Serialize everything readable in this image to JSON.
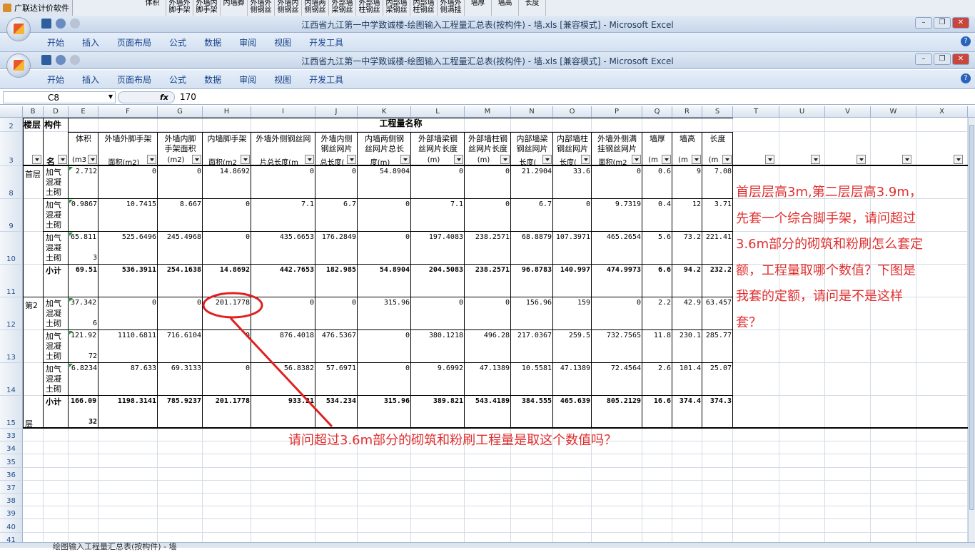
{
  "background_app": {
    "label": "广联达计价软件",
    "headers": [
      "体积",
      "外墙外脚手架",
      "外墙内脚手架",
      "内墙脚",
      "外墙外侧钢丝",
      "外墙内侧钢丝",
      "内墙两侧钢丝",
      "外部墙梁钢丝",
      "外部墙柱钢丝",
      "内部墙梁钢丝",
      "内部墙柱钢丝",
      "外墙外侧满挂",
      "墙厚",
      "墙高",
      "长度"
    ]
  },
  "windows": [
    {
      "title": "江西省九江第一中学致诚楼-绘图输入工程量汇总表(按构件) - 墙.xls  [兼容模式] - Microsoft Excel"
    },
    {
      "title": "江西省九江第一中学致诚楼-绘图输入工程量汇总表(按构件) - 墙.xls  [兼容模式] - Microsoft Excel"
    }
  ],
  "ribbon_tabs": [
    "开始",
    "插入",
    "页面布局",
    "公式",
    "数据",
    "审阅",
    "视图",
    "开发工具"
  ],
  "window_controls": {
    "minimize": "–",
    "restore": "❐",
    "close": "✕"
  },
  "formula_bar": {
    "name_box": "C8",
    "fx": "fx",
    "value": "170"
  },
  "column_headers": [
    "B",
    "D",
    "E",
    "F",
    "G",
    "H",
    "I",
    "J",
    "K",
    "L",
    "M",
    "N",
    "O",
    "P",
    "Q",
    "R",
    "S",
    "T",
    "U",
    "V",
    "W",
    "X"
  ],
  "row_numbers": [
    "2",
    "3",
    "8",
    "9",
    "10",
    "11",
    "12",
    "13",
    "14",
    "15",
    "33",
    "34",
    "35",
    "36",
    "37",
    "38",
    "39",
    "40",
    "41"
  ],
  "table_header": {
    "floor": "楼层",
    "component": "构件",
    "component_sub": "名",
    "group": "工程量名称",
    "columns": [
      {
        "l1": "体积",
        "l2": "(m3"
      },
      {
        "l1": "外墙外脚手架",
        "l2": "面积(m2)"
      },
      {
        "l1": "外墙内脚",
        "l1b": "手架面积",
        "l2": "(m2)"
      },
      {
        "l1": "内墙脚手架",
        "l2": "面积(m2"
      },
      {
        "l1": "外墙外侧钢丝网",
        "l2": "片总长度(m"
      },
      {
        "l1": "外墙内侧",
        "l1b": "钢丝网片",
        "l2": "总长度("
      },
      {
        "l1": "内墙两侧钢",
        "l1b": "丝网片总长",
        "l2": "度(m)"
      },
      {
        "l1": "外部墙梁钢",
        "l1b": "丝网片长度",
        "l2": "(m)"
      },
      {
        "l1": "外部墙柱钢",
        "l1b": "丝网片长度",
        "l2": "(m)"
      },
      {
        "l1": "内部墙梁",
        "l1b": "钢丝网片",
        "l2": "长度("
      },
      {
        "l1": "内部墙柱",
        "l1b": "钢丝网片",
        "l2": "长度("
      },
      {
        "l1": "外墙外侧满",
        "l1b": "挂钢丝网片",
        "l2": "面积(m2"
      },
      {
        "l1": "墙厚",
        "l2": "(m"
      },
      {
        "l1": "墙高",
        "l2": "(m"
      },
      {
        "l1": "长度",
        "l2": "(m"
      }
    ]
  },
  "rows": [
    {
      "floor": "首层",
      "component": "加气混凝土砌",
      "values": [
        "2.712",
        "0",
        "0",
        "14.8692",
        "0",
        "0",
        "54.8904",
        "0",
        "0",
        "21.2904",
        "33.6",
        "0",
        "0.6",
        "9",
        "7.08"
      ]
    },
    {
      "floor": "",
      "component": "加气混凝土砌",
      "values": [
        "0.9867",
        "10.7415",
        "8.667",
        "0",
        "7.1",
        "6.7",
        "0",
        "7.1",
        "0",
        "6.7",
        "0",
        "9.7319",
        "0.4",
        "12",
        "3.71"
      ]
    },
    {
      "floor": "",
      "component": "加气混凝土砌",
      "values": [
        "65.8113",
        "525.6496",
        "245.4968",
        "0",
        "435.6653",
        "176.2849",
        "0",
        "197.4083",
        "238.2571",
        "68.8879",
        "107.3971",
        "465.2654",
        "5.6",
        "73.2",
        "221.41"
      ]
    },
    {
      "floor": "",
      "component": "小计",
      "subtotal": true,
      "values": [
        "69.51",
        "536.3911",
        "254.1638",
        "14.8692",
        "442.7653",
        "182.985",
        "54.8904",
        "204.5083",
        "238.2571",
        "96.8783",
        "140.997",
        "474.9973",
        "6.6",
        "94.2",
        "232.2"
      ]
    },
    {
      "floor": "第2",
      "component": "加气混凝土砌",
      "values": [
        "37.3426",
        "0",
        "0",
        "201.1778",
        "0",
        "0",
        "315.96",
        "0",
        "0",
        "156.96",
        "159",
        "0",
        "2.2",
        "42.9",
        "63.457"
      ]
    },
    {
      "floor": "",
      "component": "加气混凝土砌",
      "values": [
        "121.9272",
        "1110.6811",
        "716.6104",
        "0",
        "876.4018",
        "476.5367",
        "0",
        "380.1218",
        "496.28",
        "217.0367",
        "259.5",
        "732.7565",
        "11.8",
        "230.1",
        "285.77"
      ]
    },
    {
      "floor": "",
      "component": "加气混凝土砌",
      "values": [
        "6.8234",
        "87.633",
        "69.3133",
        "0",
        "56.8382",
        "57.6971",
        "0",
        "9.6992",
        "47.1389",
        "10.5581",
        "47.1389",
        "72.4564",
        "2.6",
        "101.4",
        "25.07"
      ]
    },
    {
      "floor": "层",
      "component": "小计",
      "subtotal": true,
      "values": [
        "166.0932",
        "1198.3141",
        "785.9237",
        "201.1778",
        "933.21",
        "534.234",
        "315.96",
        "389.821",
        "543.4189",
        "384.555",
        "465.639",
        "805.2129",
        "16.6",
        "374.4",
        "374.3"
      ]
    }
  ],
  "annotation_right": [
    "首层层高3m,第二层层高3.9m，",
    "先套一个综合脚手架，请问超过",
    "3.6m部分的砌筑和粉刷怎么套定",
    "额，工程量取哪个数值？下图是",
    "我套的定额，请问是不是这样",
    "套？"
  ],
  "annotation_bottom": "请问超过3.6m部分的砌筑和粉刷工程量是取这个数值吗？",
  "sheet_tab": "绘图输入工程量汇总表(按构件) - 墙",
  "colors": {
    "annotation": "#e03030",
    "circle": "#e02020",
    "ribbon_text": "#15428b"
  }
}
